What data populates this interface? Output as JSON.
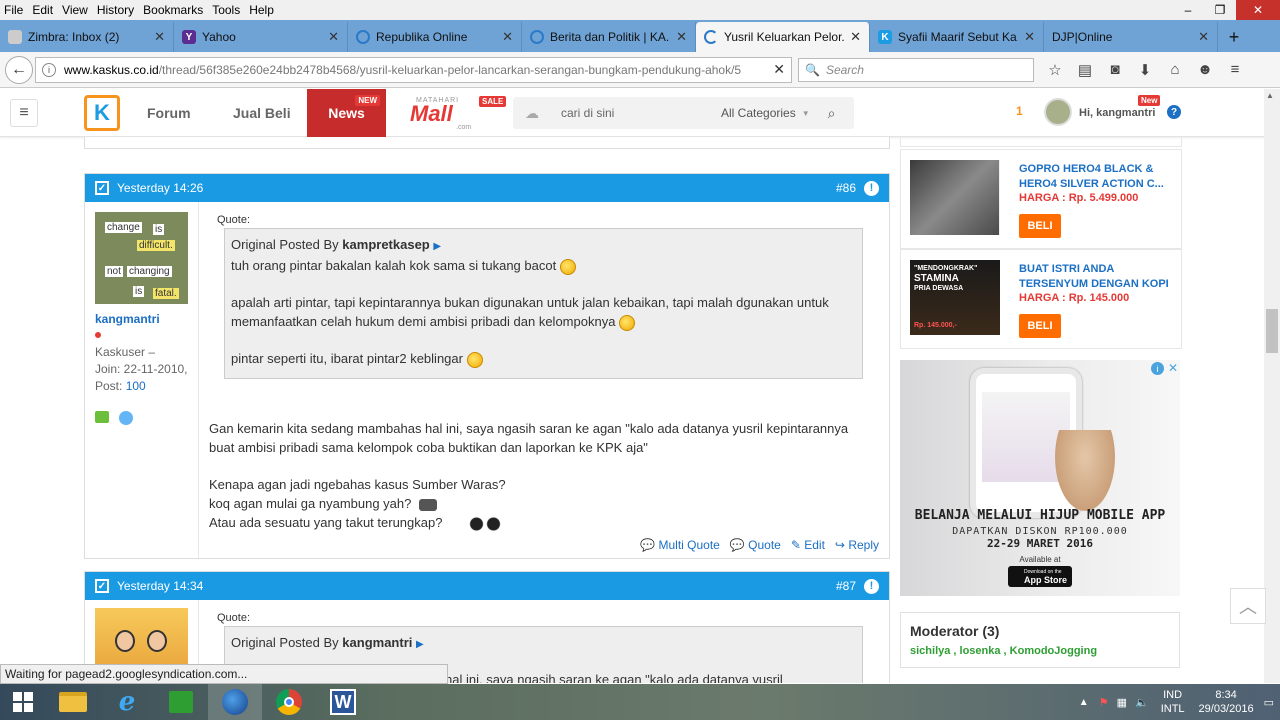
{
  "menu": [
    "File",
    "Edit",
    "View",
    "History",
    "Bookmarks",
    "Tools",
    "Help"
  ],
  "window_controls": {
    "minimize": "–",
    "restore": "❐",
    "close": "✕"
  },
  "tabs": [
    {
      "title": "Zimbra: Inbox (2)",
      "color": "#cccccc"
    },
    {
      "title": "Yahoo",
      "color": "#5c2d91"
    },
    {
      "title": "Republika Online",
      "color": "#2a7ac8"
    },
    {
      "title": "Berita dan Politik | KA...",
      "color": "#2a7ac8"
    },
    {
      "title": "Yusril Keluarkan Pelor...",
      "color": "#2a7ac8"
    },
    {
      "title": "Syafii Maarif Sebut Ka...",
      "color": "#1d9ce3"
    },
    {
      "title": "DJP|Online",
      "color": "#dddddd"
    }
  ],
  "nav": {
    "url_domain": "www.kaskus.co.id",
    "url_path": "/thread/56f385e260e24bb2478b4568/yusril-keluarkan-pelor-lancarkan-serangan-bungkam-pendukung-ahok/5",
    "search_placeholder": "Search"
  },
  "site": {
    "forum": "Forum",
    "jualbeli": "Jual Beli",
    "news": "News",
    "news_badge": "NEW",
    "mall_top": "MATAHARI",
    "mall_name": "Mall",
    "mall_sub": ".com",
    "mall_badge": "SALE",
    "search_placeholder": "cari di sini",
    "category": "All Categories",
    "notif": "1",
    "greeting": "Hi, kangmantri",
    "greeting_badge": "New"
  },
  "posts": [
    {
      "time": "Yesterday 14:26",
      "num": "#86",
      "user": "kangmantri",
      "rank": "Kaskuser",
      "join": "Join: 22-11-2010,",
      "post_label": "Post:",
      "post_count": "100",
      "avatar_words": [
        "change",
        "is",
        "difficult.",
        "not",
        "changing",
        "is",
        "fatal."
      ],
      "quote_label": "Quote:",
      "quote_by_label": "Original Posted By",
      "quote_by": "kampretkasep",
      "quote_lines": [
        "tuh orang pintar bakalan kalah kok sama si tukang bacot",
        "apalah arti pintar, tapi kepintarannya bukan digunakan untuk jalan kebaikan, tapi malah dgunakan untuk memanfaatkan celah hukum demi ambisi pribadi dan kelompoknya",
        "pintar seperti itu, ibarat pintar2 keblingar"
      ],
      "body": [
        "Gan kemarin kita sedang mambahas hal ini, saya ngasih saran ke agan \"kalo ada datanya yusril kepintarannya buat ambisi pribadi sama kelompok coba buktikan dan laporkan ke KPK aja\"",
        "Kenapa agan jadi ngebahas kasus Sumber Waras?",
        "koq agan mulai ga nyambung yah?",
        "Atau ada sesuatu yang takut terungkap?"
      ],
      "actions": [
        "Multi Quote",
        "Quote",
        "Edit",
        "Reply"
      ]
    },
    {
      "time": "Yesterday 14:34",
      "num": "#87",
      "quote_label": "Quote:",
      "quote_by_label": "Original Posted By",
      "quote_by": "kangmantri",
      "quote_line": "hal ini, saya ngasih saran ke agan \"kalo ada datanya yusril"
    }
  ],
  "sidebar": {
    "products": [
      {
        "title": "GOPRO HERO4 BLACK & HERO4 SILVER ACTION C...",
        "price": "HARGA : Rp. 5.499.000",
        "buy": "BELI"
      },
      {
        "title": "BUAT ISTRI ANDA TERSENYUM DENGAN KOPI",
        "price": "HARGA : Rp. 145.000",
        "buy": "BELI",
        "img_text_1": "\"MENDONGKRAK\"",
        "img_text_2": "STAMINA",
        "img_text_3": "PRIA DEWASA",
        "img_price": "Rp. 145.000,-"
      }
    ],
    "ad": {
      "headline": "BELANJA MELALUI HIJUP MOBILE APP",
      "sub": "DAPATKAN DISKON RP100.000",
      "date": "22-29 MARET 2016",
      "avail": "Available at",
      "store_small": "Download on the",
      "store": "App Store"
    },
    "moderator_title": "Moderator (3)",
    "moderators": "sichilya , losenka , KomodoJogging"
  },
  "status": "Waiting for pagead2.googlesyndication.com...",
  "tray": {
    "lang1": "IND",
    "lang2": "INTL",
    "time": "8:34",
    "date": "29/03/2016"
  }
}
